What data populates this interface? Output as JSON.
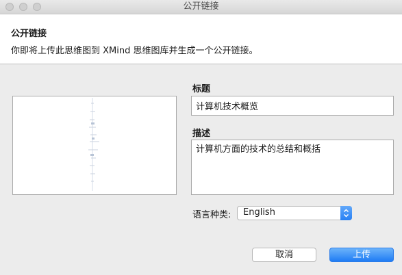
{
  "window": {
    "title": "公开链接"
  },
  "header": {
    "title": "公开链接",
    "description": "你即将上传此思维图到 XMind 思维图库并生成一个公开链接。"
  },
  "form": {
    "title_label": "标题",
    "title_value": "计算机技术概览",
    "description_label": "描述",
    "description_value": "计算机方面的技术的总结和概括",
    "language_label": "语言种类:",
    "language_value": "English"
  },
  "buttons": {
    "cancel_label": "取消",
    "upload_label": "上传"
  },
  "colors": {
    "accent": "#2a7ff5",
    "background": "#ececec"
  }
}
